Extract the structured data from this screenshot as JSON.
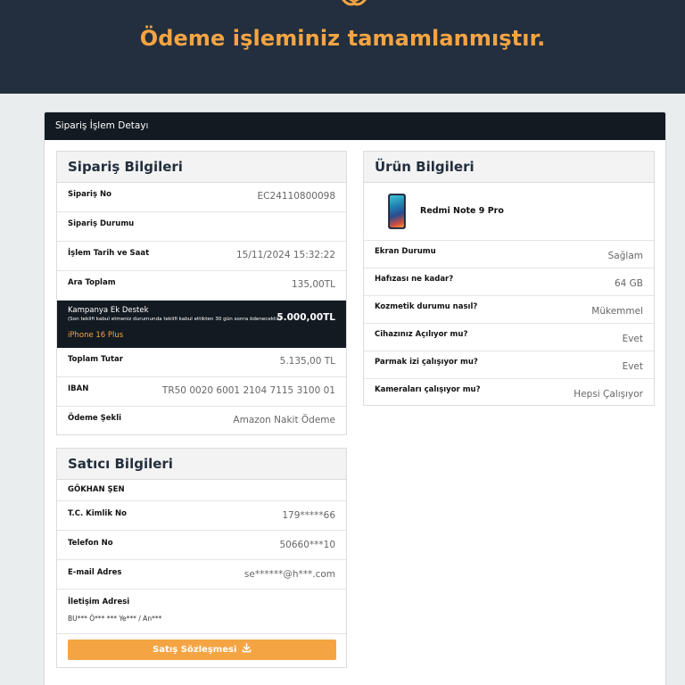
{
  "hero": {
    "title": "Ödeme işleminiz tamamlanmıştır."
  },
  "detail": {
    "header": "Sipariş İşlem Detayı"
  },
  "order": {
    "heading": "Sipariş Bilgileri",
    "order_no_label": "Sipariş No",
    "order_no_value": "EC24110800098",
    "status_label": "Sipariş Durumu",
    "datetime_label": "İşlem Tarih ve Saat",
    "datetime_value": "15/11/2024 15:32:22",
    "subtotal_label": "Ara Toplam",
    "subtotal_value": "135,00TL",
    "campaign_title": "Kampanya Ek Destek",
    "campaign_note": "(Son teklifi kabul etmeniz durumunda teklifi kabul ettikten 30 gün sonra ödenecektir)",
    "campaign_device": "iPhone 16 Plus",
    "campaign_amount": "5.000,00TL",
    "total_label": "Toplam Tutar",
    "total_value": "5.135,00 TL",
    "iban_label": "IBAN",
    "iban_value": "TR50 0020 6001 2104 7115 3100 01",
    "payment_label": "Ödeme Şekli",
    "payment_value": "Amazon Nakit Ödeme"
  },
  "seller": {
    "heading": "Satıcı Bilgileri",
    "name": "GÖKHAN ŞEN",
    "tc_label": "T.C. Kimlik No",
    "tc_value": "179*****66",
    "phone_label": "Telefon No",
    "phone_value": "50660***10",
    "email_label": "E-mail Adres",
    "email_value": "se******@h***.com",
    "address_label": "İletişim Adresi",
    "address_value": "BU*** Ö*** *** Ye*** / An***",
    "contract_button": "Satış Sözleşmesi"
  },
  "product": {
    "heading": "Ürün Bilgileri",
    "name": "Redmi Note 9 Pro",
    "screen_label": "Ekran Durumu",
    "screen_value": "Sağlam",
    "storage_label": "Hafızası ne kadar?",
    "storage_value": "64 GB",
    "cosmetic_label": "Kozmetik durumu nasıl?",
    "cosmetic_value": "Mükemmel",
    "power_label": "Cihazınız Açılıyor mu?",
    "power_value": "Evet",
    "fingerprint_label": "Parmak izi çalışıyor mu?",
    "fingerprint_value": "Evet",
    "camera_label": "Kameraları çalışıyor mu?",
    "camera_value": "Hepsi Çalışıyor"
  },
  "icons": {
    "hero": "handshake-icon",
    "download": "download-icon",
    "product_image": "smartphone-image"
  },
  "colors": {
    "header_bg": "#232f3e",
    "accent": "#f5a443",
    "dark_bar": "#131a22"
  }
}
